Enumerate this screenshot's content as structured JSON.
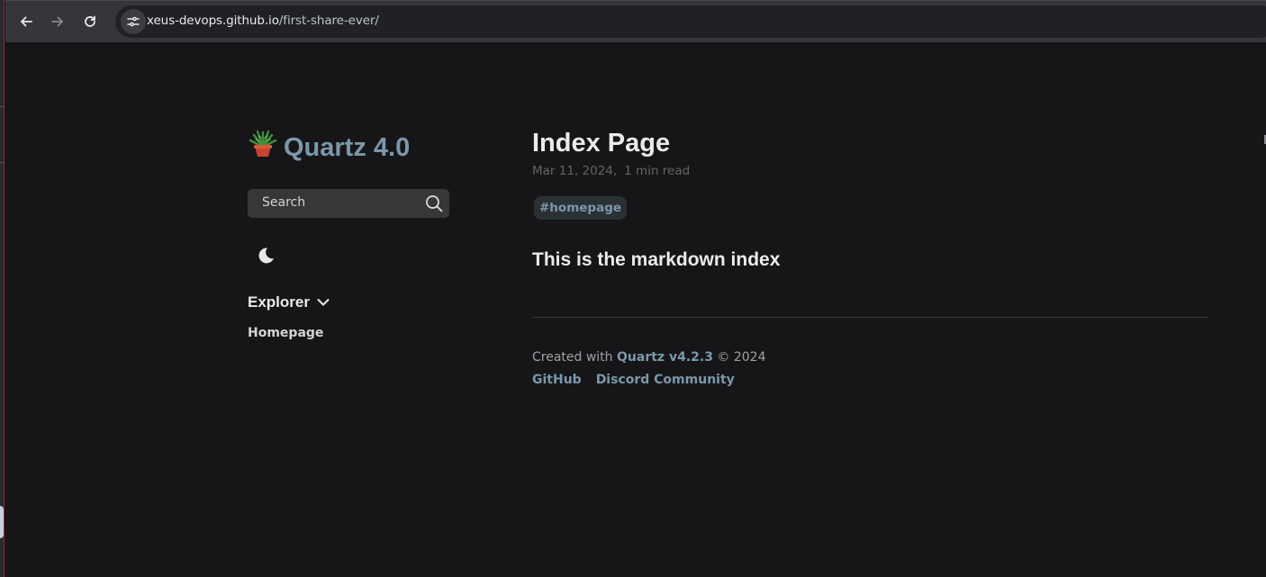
{
  "browser": {
    "url_host": "xeus-devops.github.io",
    "url_path": "/first-share-ever/",
    "back_icon": "arrow-left-icon",
    "forward_icon": "arrow-right-icon",
    "reload_icon": "reload-icon",
    "site_info_icon": "tune-icon"
  },
  "sidebar": {
    "site_title": "Quartz 4.0",
    "site_logo_icon": "potted-plant-icon",
    "search_label": "Search",
    "theme_icon": "moon-icon",
    "explorer_label": "Explorer",
    "explorer_items": [
      "Homepage"
    ]
  },
  "main": {
    "title": "Index Page",
    "date": "Mar 11, 2024,",
    "read_time": "1 min read",
    "tag": "#homepage",
    "heading": "This is the markdown index"
  },
  "footer": {
    "created_prefix": "Created with",
    "quartz_link": "Quartz v4.2.3",
    "copyright": "© 2024",
    "links": [
      "GitHub",
      "Discord Community"
    ]
  },
  "colors": {
    "background": "#161618",
    "accent": "#7b97aa",
    "text": "#ebebec",
    "muted": "#646464"
  }
}
